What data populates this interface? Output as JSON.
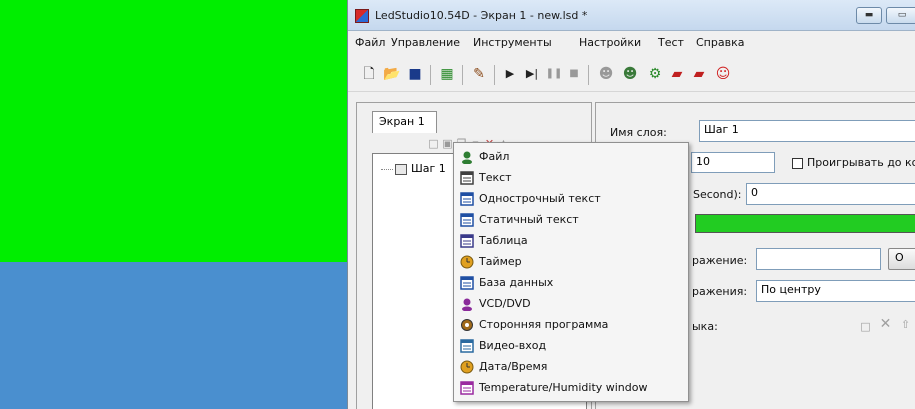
{
  "window": {
    "title": "LedStudio10.54D - Экран 1 - new.lsd *"
  },
  "menubar": {
    "items": [
      "Файл",
      "Управление",
      "Инструменты",
      "Настройки",
      "Тест",
      "Справка"
    ]
  },
  "left_panel": {
    "tab_label": "Экран 1",
    "tree_node_label": "Шаг 1"
  },
  "right_panel": {
    "layer_name_label": "Имя слоя:",
    "layer_name_value": "Шаг 1",
    "count_value": "10",
    "play_until_label": "Проигрывать до ко",
    "second_label": "Second):",
    "second_value": "0",
    "expression_label": "ражение:",
    "expression_value": "",
    "browse_label": "О",
    "alignment_label": "ражения:",
    "alignment_value": "По центру",
    "language_label": "ыка:",
    "progress_fraction": 1.0
  },
  "context_menu": {
    "items": [
      {
        "label": "Файл",
        "icon": "file-person-icon",
        "color": "#2e7d32"
      },
      {
        "label": "Текст",
        "icon": "text-grid-icon",
        "color": "#404040"
      },
      {
        "label": "Однострочный текст",
        "icon": "single-line-text-icon",
        "color": "#1f4fa3"
      },
      {
        "label": "Статичный текст",
        "icon": "static-text-icon",
        "color": "#1f4fa3"
      },
      {
        "label": "Таблица",
        "icon": "table-icon",
        "color": "#3a3a8a"
      },
      {
        "label": "Таймер",
        "icon": "timer-icon",
        "color": "#e0a020"
      },
      {
        "label": "База данных",
        "icon": "database-icon",
        "color": "#1f4fa3"
      },
      {
        "label": "VCD/DVD",
        "icon": "disc-icon",
        "color": "#8a2a9a"
      },
      {
        "label": "Сторонняя программа",
        "icon": "third-party-program-icon",
        "color": "#a06a1a"
      },
      {
        "label": "Видео-вход",
        "icon": "video-input-icon",
        "color": "#2a6aa0"
      },
      {
        "label": "Дата/Время",
        "icon": "clock-icon",
        "color": "#e0a020"
      },
      {
        "label": "Temperature/Humidity window",
        "icon": "temperature-humidity-icon",
        "color": "#9a2aa0"
      }
    ]
  }
}
